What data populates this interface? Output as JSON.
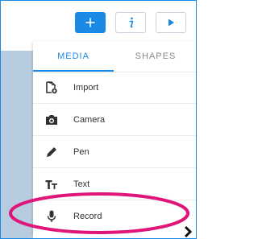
{
  "toolbar": {
    "add_icon": "plus-icon",
    "info_icon": "info-icon",
    "play_icon": "play-icon"
  },
  "tabs": [
    {
      "label": "MEDIA",
      "active": true
    },
    {
      "label": "SHAPES",
      "active": false
    }
  ],
  "menu": {
    "items": [
      {
        "label": "Import",
        "icon": "import-file-icon"
      },
      {
        "label": "Camera",
        "icon": "camera-icon"
      },
      {
        "label": "Pen",
        "icon": "pen-icon"
      },
      {
        "label": "Text",
        "icon": "text-icon"
      },
      {
        "label": "Record",
        "icon": "microphone-icon"
      }
    ]
  },
  "colors": {
    "accent": "#1a8ae6",
    "annotation": "#e0157a",
    "background_strip": "#b8cce0"
  }
}
